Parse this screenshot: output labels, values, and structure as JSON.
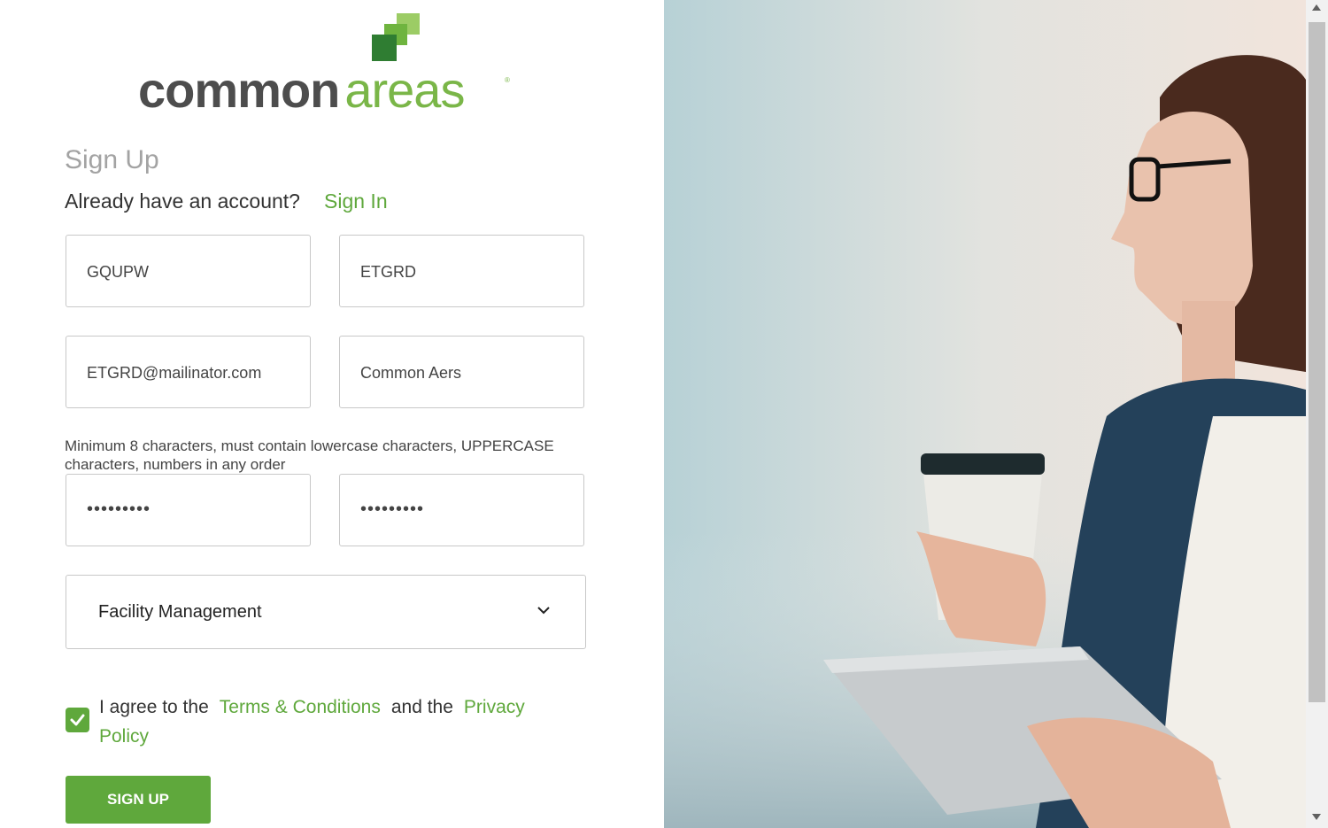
{
  "logo": {
    "word1": "common",
    "word2": "areas",
    "trademark": "®"
  },
  "form": {
    "title": "Sign Up",
    "already_text": "Already have an account?",
    "signin_label": "Sign In",
    "first_name": "GQUPW",
    "last_name": "ETGRD",
    "email": "ETGRD@mailinator.com",
    "company": "Common Aers",
    "password_hint": "Minimum 8 characters, must contain lowercase characters, UPPERCASE characters, numbers in any order",
    "password_mask": "•••••••••",
    "confirm_mask": "•••••••••",
    "role_selected": "Facility Management",
    "agree_prefix": "I agree to the",
    "terms_label": "Terms & Conditions",
    "agree_mid": "and the",
    "privacy_label": "Privacy Policy",
    "signup_label": "SIGN UP"
  },
  "colors": {
    "accent": "#5fa83c",
    "logo_dark": "#4d4d4d",
    "logo_green": "#7ab648"
  },
  "icons": {
    "checkbox": "check-icon",
    "select_arrow": "chevron-down-icon"
  }
}
